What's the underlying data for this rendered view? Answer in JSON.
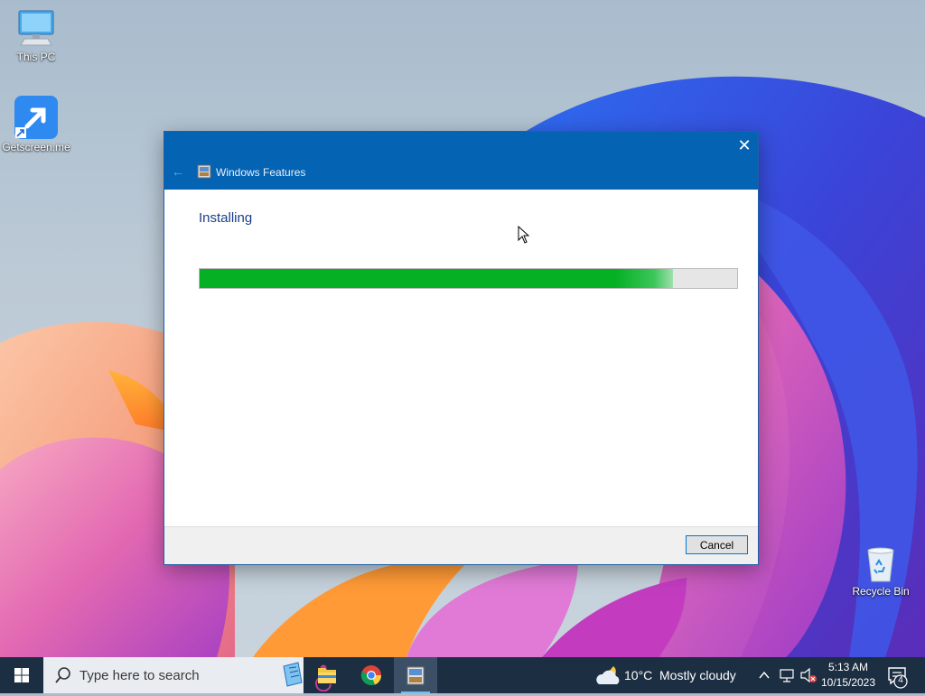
{
  "desktop": {
    "icons": [
      {
        "label": "This PC",
        "icon": "computer-icon"
      },
      {
        "label": "Getscreen.me",
        "icon": "getscreen-shortcut-icon"
      },
      {
        "label": "Recycle Bin",
        "icon": "recycle-bin-icon"
      }
    ]
  },
  "dialog": {
    "title": "Windows Features",
    "close_glyph": "✕",
    "back_glyph": "←",
    "heading": "Installing",
    "progress": 0.88,
    "cancel_label": "Cancel"
  },
  "taskbar": {
    "search_placeholder": "Type here to search",
    "apps": [
      "file-explorer-icon",
      "chrome-icon",
      "windows-features-icon"
    ],
    "weather": {
      "temperature": "10°C",
      "condition": "Mostly cloudy"
    },
    "clock": {
      "time": "5:13 AM",
      "date": "10/15/2023"
    },
    "notification_count": "4"
  },
  "colors": {
    "accent": "#0563b4",
    "progress_green": "#06b025",
    "taskbar": "#1c2e42"
  }
}
